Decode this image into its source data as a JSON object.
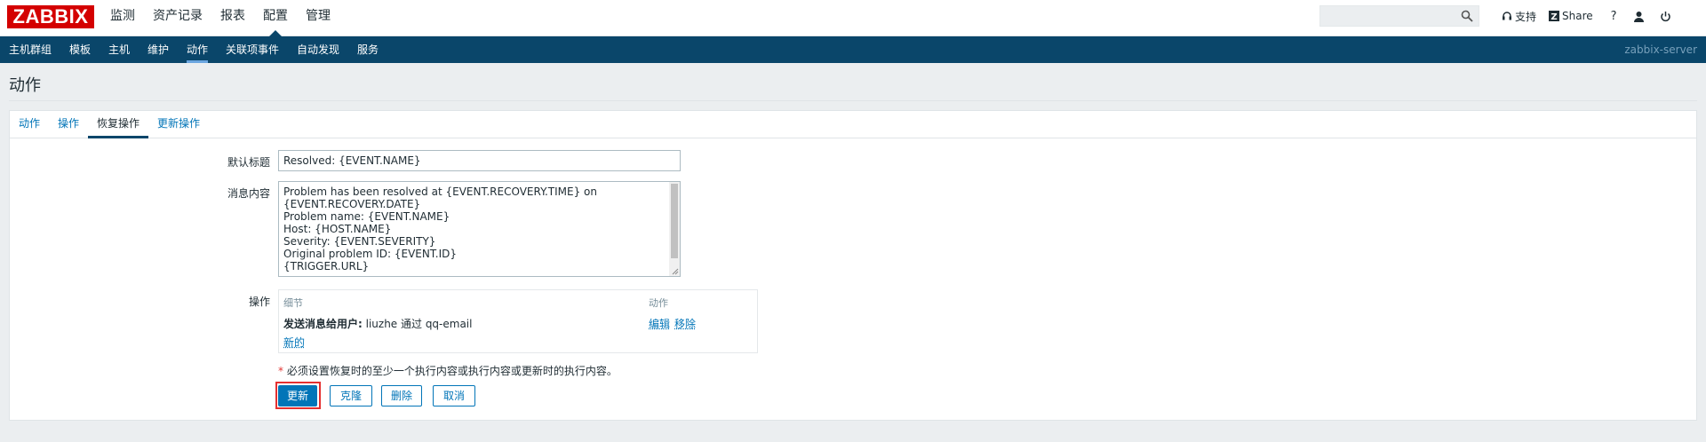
{
  "logo": "ZABBIX",
  "top_menu": [
    "监测",
    "资产记录",
    "报表",
    "配置",
    "管理"
  ],
  "top_menu_active": "配置",
  "search": {
    "placeholder": "",
    "icon": "search-icon"
  },
  "right_menu": {
    "support": "支持",
    "share": "Share",
    "help": "?",
    "user_icon": "user-icon",
    "power_icon": "power-icon"
  },
  "sub_menu": [
    "主机群组",
    "模板",
    "主机",
    "维护",
    "动作",
    "关联项事件",
    "自动发现",
    "服务"
  ],
  "sub_menu_active": "动作",
  "server_name": "zabbix-server",
  "page": {
    "title": "动作"
  },
  "tabs": [
    "动作",
    "操作",
    "恢复操作",
    "更新操作"
  ],
  "tab_active": "恢复操作",
  "form": {
    "subject_label": "默认标题",
    "subject_value": "Resolved: {EVENT.NAME}",
    "message_label": "消息内容",
    "message_lines": [
      "Problem has been resolved at {EVENT.RECOVERY.TIME} on",
      "{EVENT.RECOVERY.DATE}",
      "Problem name: {EVENT.NAME}",
      "Host: {HOST.NAME}",
      "Severity: {EVENT.SEVERITY}",
      "",
      "Original problem ID: {EVENT.ID}",
      "{TRIGGER.URL}"
    ],
    "operations_label": "操作",
    "operations": {
      "col_details": "细节",
      "col_action": "动作",
      "row_bold": "发送消息给用户:",
      "row_text": " liuzhe 通过 qq-email",
      "edit": "编辑",
      "remove": "移除",
      "new": "新的"
    },
    "required_star": "*",
    "required_note": "必须设置恢复时的至少一个执行内容或执行内容或更新时的执行内容。"
  },
  "buttons": {
    "update": "更新",
    "clone": "克隆",
    "delete": "删除",
    "cancel": "取消"
  },
  "colors": {
    "brand": "#d40000",
    "nav": "#0a466a",
    "link": "#0275b8",
    "highlight": "#e53030"
  }
}
